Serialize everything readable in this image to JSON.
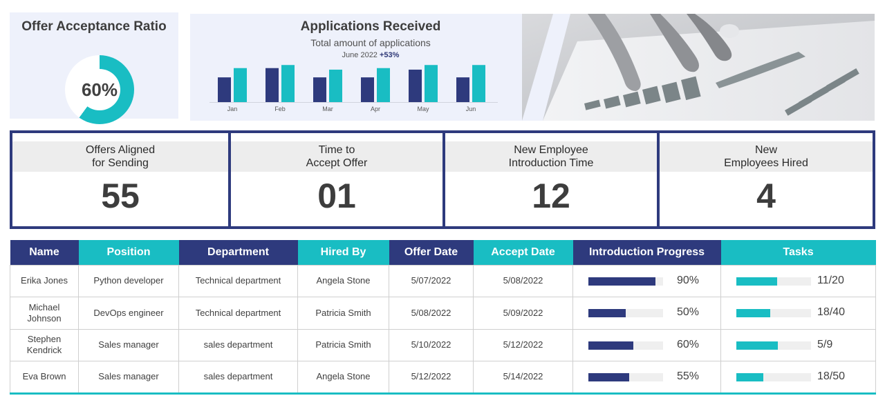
{
  "offer_acceptance": {
    "title": "Offer Acceptance Ratio",
    "value": 60,
    "value_label": "60%",
    "colors": {
      "fill": "#19bdc3",
      "track": "#ffffff"
    }
  },
  "applications": {
    "title": "Applications Received",
    "subtitle": "Total amount of applications",
    "period": "June 2022",
    "change": "+53%"
  },
  "chart_data": {
    "type": "bar",
    "title": "Applications Received",
    "subtitle": "Total amount of applications",
    "categories": [
      "Jan",
      "Feb",
      "Mar",
      "Apr",
      "May",
      "Jun"
    ],
    "series": [
      {
        "values": [
          32,
          44,
          32,
          32,
          42,
          32
        ],
        "color": "#2e3a7d"
      },
      {
        "values": [
          44,
          48,
          42,
          44,
          48,
          48
        ],
        "color": "#19bdc3"
      }
    ],
    "ylim": [
      0,
      50
    ],
    "grid": false,
    "legend": "none"
  },
  "kpis": [
    {
      "label": "Offers  Aligned\nfor Sending",
      "value": "55"
    },
    {
      "label": "Time to\nAccept Offer",
      "value": "01"
    },
    {
      "label": "New Employee\nIntroduction Time",
      "value": "12"
    },
    {
      "label": "New\nEmployees Hired",
      "value": "4"
    }
  ],
  "table": {
    "headers": [
      "Name",
      "Position",
      "Department",
      "Hired By",
      "Offer Date",
      "Accept Date",
      "Introduction Progress",
      "Tasks"
    ],
    "rows": [
      {
        "name": "Erika Jones",
        "position": "Python developer",
        "department": "Technical department",
        "hired_by": "Angela Stone",
        "offer_date": "5/07/2022",
        "accept_date": "5/08/2022",
        "progress": 90,
        "progress_label": "90%",
        "tasks_done": 11,
        "tasks_total": 20,
        "tasks_label": "11/20"
      },
      {
        "name": "Michael Johnson",
        "position": "DevOps  engineer",
        "department": "Technical department",
        "hired_by": "Patricia Smith",
        "offer_date": "5/08/2022",
        "accept_date": "5/09/2022",
        "progress": 50,
        "progress_label": "50%",
        "tasks_done": 18,
        "tasks_total": 40,
        "tasks_label": "18/40"
      },
      {
        "name": "Stephen Kendrick",
        "position": "Sales manager",
        "department": "sales department",
        "hired_by": "Patricia Smith",
        "offer_date": "5/10/2022",
        "accept_date": "5/12/2022",
        "progress": 60,
        "progress_label": "60%",
        "tasks_done": 5,
        "tasks_total": 9,
        "tasks_label": "5/9"
      },
      {
        "name": "Eva Brown",
        "position": "Sales manager",
        "department": "sales department",
        "hired_by": "Angela Stone",
        "offer_date": "5/12/2022",
        "accept_date": "5/14/2022",
        "progress": 55,
        "progress_label": "55%",
        "tasks_done": 18,
        "tasks_total": 50,
        "tasks_label": "18/50"
      }
    ]
  },
  "colors": {
    "navy": "#2e3a7d",
    "teal": "#19bdc3",
    "panel": "#eef1fb"
  }
}
